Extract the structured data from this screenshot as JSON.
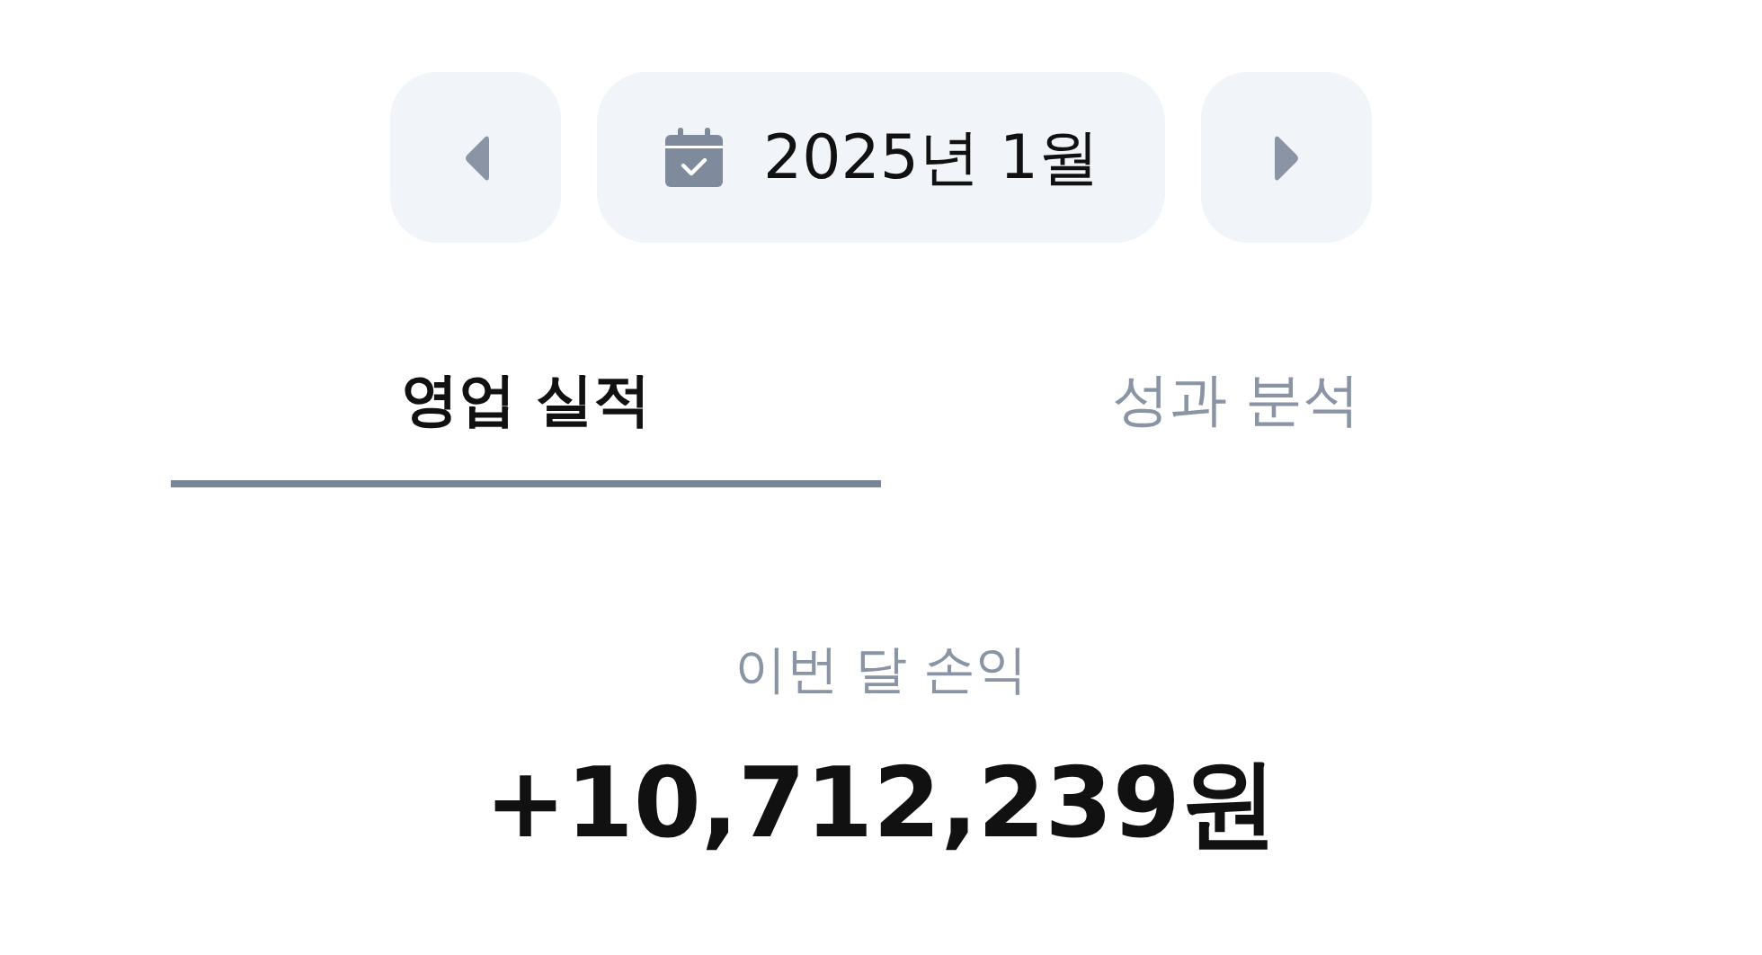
{
  "month_nav": {
    "prev": {
      "disabled": false
    },
    "month": "2025년 1월",
    "next": {
      "disabled": false
    }
  },
  "tabs": [
    {
      "label": "영업 실적",
      "selected": true
    },
    {
      "label": "성과 분석",
      "selected": false
    }
  ],
  "summary": {
    "label": "이번 달 손익",
    "amount": "+10,712,239원"
  }
}
